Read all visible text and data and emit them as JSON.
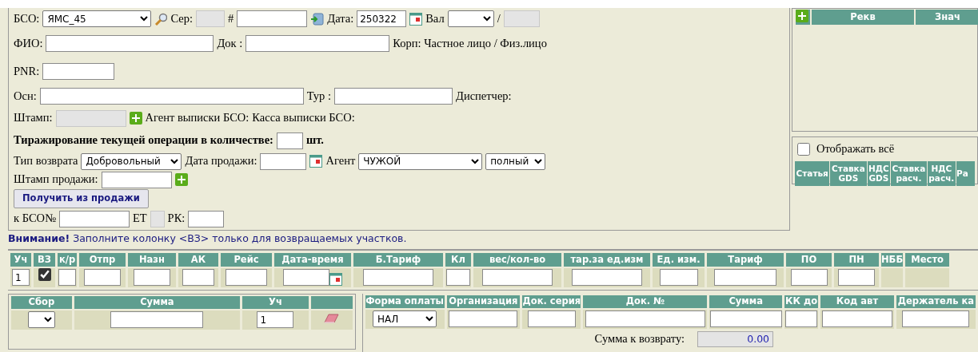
{
  "form": {
    "lines": [
      {
        "items": [
          {
            "kind": "label",
            "text": "БСО:"
          },
          {
            "kind": "select",
            "value": "ЯМС_45"
          },
          {
            "kind": "search"
          },
          {
            "kind": "label",
            "text": "Сер:"
          },
          {
            "kind": "input",
            "disabled": true
          },
          {
            "kind": "label",
            "text": "#"
          },
          {
            "kind": "input",
            "disabled": false
          },
          {
            "kind": "import"
          },
          {
            "kind": "label",
            "text": "Дата:"
          },
          {
            "kind": "input",
            "value": "250322",
            "disabled": false
          },
          {
            "kind": "calendar"
          },
          {
            "kind": "label",
            "text": "Вал"
          },
          {
            "kind": "select"
          },
          {
            "kind": "label",
            "text": "/"
          },
          {
            "kind": "input",
            "disabled": true
          }
        ]
      },
      {
        "items": [
          {
            "kind": "label",
            "text": "ФИО:"
          },
          {
            "kind": "input",
            "disabled": false
          },
          {
            "kind": "label",
            "text": "Док :"
          },
          {
            "kind": "input",
            "disabled": false
          },
          {
            "kind": "label",
            "text": "Корп: Частное лицо / Физ.лицо"
          }
        ]
      },
      {
        "items": [
          {
            "kind": "label",
            "text": "PNR:"
          },
          {
            "kind": "input",
            "disabled": false
          }
        ]
      },
      {
        "items": [
          {
            "kind": "label",
            "text": "Осн:"
          },
          {
            "kind": "input",
            "disabled": false
          },
          {
            "kind": "label",
            "text": "Тур :"
          },
          {
            "kind": "input",
            "disabled": false
          },
          {
            "kind": "label",
            "text": "Диспетчер:"
          }
        ]
      },
      {
        "items": [
          {
            "kind": "label",
            "text": "Штамп:"
          },
          {
            "kind": "input",
            "disabled": true
          },
          {
            "kind": "add"
          },
          {
            "kind": "label",
            "text": "Агент выписки БСО:"
          },
          {
            "kind": "label",
            "text": "Касса выписки БСО:"
          }
        ]
      },
      {
        "items": [
          {
            "kind": "strong",
            "text": "Тиражирование текущей операции в количестве:"
          },
          {
            "kind": "input",
            "disabled": false
          },
          {
            "kind": "strong",
            "text": "шт."
          }
        ]
      },
      {
        "items": [
          {
            "kind": "label",
            "text": "Тип возврата"
          },
          {
            "kind": "select",
            "value": "Добровольный"
          },
          {
            "kind": "label",
            "text": "Дата продажи:"
          },
          {
            "kind": "input",
            "disabled": false
          },
          {
            "kind": "calendar"
          },
          {
            "kind": "label",
            "text": "Агент"
          },
          {
            "kind": "select",
            "value": "ЧУЖОЙ"
          },
          {
            "kind": "select",
            "value": "полный"
          }
        ]
      },
      {
        "items": [
          {
            "kind": "label",
            "text": "Штамп продажи:"
          },
          {
            "kind": "input",
            "disabled": false
          },
          {
            "kind": "add"
          }
        ]
      },
      {
        "items": [
          {
            "kind": "button",
            "text": "Получить из продажи"
          }
        ]
      },
      {
        "items": [
          {
            "kind": "label",
            "text": "к БСО№"
          },
          {
            "kind": "input",
            "disabled": false
          },
          {
            "kind": "label",
            "text": "ЕТ"
          },
          {
            "kind": "input",
            "disabled": true
          },
          {
            "kind": "label",
            "text": "РК:"
          },
          {
            "kind": "input",
            "disabled": false
          }
        ]
      }
    ]
  },
  "requisites": {
    "columns": [
      "Рекв",
      "Знач"
    ]
  },
  "rates": {
    "show_all": {
      "label": "Отображать всё",
      "checked": false
    },
    "columns": [
      "Статья",
      "Ставка GDS",
      "НДС GDS",
      "Ставка расч.",
      "НДС расч.",
      "Ра"
    ]
  },
  "notice": "**Внимание!** Заполните колонку <ВЗ> только для возвращаемых участков.",
  "segments": {
    "columns": [
      "Уч",
      "ВЗ",
      "к/р",
      "Отпр",
      "Назн",
      "АК",
      "Рейс",
      "Дата-время",
      "Б.Тариф",
      "Кл",
      "вес/кол-во",
      "тар.за ед.изм",
      "Ед. изм.",
      "Тариф",
      "ПО",
      "ПН",
      "НББ",
      "Место"
    ],
    "row": [
      {
        "kind": "input",
        "value": "1"
      },
      {
        "kind": "checkbox",
        "checked": true
      },
      {
        "kind": "input"
      },
      {
        "kind": "input"
      },
      {
        "kind": "input"
      },
      {
        "kind": "input"
      },
      {
        "kind": "input"
      },
      {
        "kind": "datetime"
      },
      {
        "kind": "input"
      },
      {
        "kind": "input"
      },
      {
        "kind": "input"
      },
      {
        "kind": "input"
      },
      {
        "kind": "input"
      },
      {
        "kind": "input"
      },
      {
        "kind": "input"
      },
      {
        "kind": "input"
      },
      {
        "kind": "empty"
      },
      {
        "kind": "empty"
      }
    ]
  },
  "fees": {
    "columns": [
      "Сбор",
      "Сумма",
      "Уч",
      ""
    ],
    "row": [
      {
        "kind": "select"
      },
      {
        "kind": "input"
      },
      {
        "kind": "input",
        "value": "1"
      },
      {
        "kind": "eraser"
      }
    ]
  },
  "payments": {
    "columns": [
      "Форма оплаты",
      "Организация",
      "Док. серия",
      "Док. №",
      "Сумма",
      "КК до",
      "Код авт",
      "Держатель ка"
    ],
    "row": [
      {
        "kind": "select",
        "value": "НАЛ"
      },
      {
        "kind": "input"
      },
      {
        "kind": "input"
      },
      {
        "kind": "input"
      },
      {
        "kind": "input"
      },
      {
        "kind": "input"
      },
      {
        "kind": "input"
      },
      {
        "kind": "input"
      }
    ],
    "total": {
      "label": "Сумма к возврату:",
      "value": "0.00"
    }
  }
}
